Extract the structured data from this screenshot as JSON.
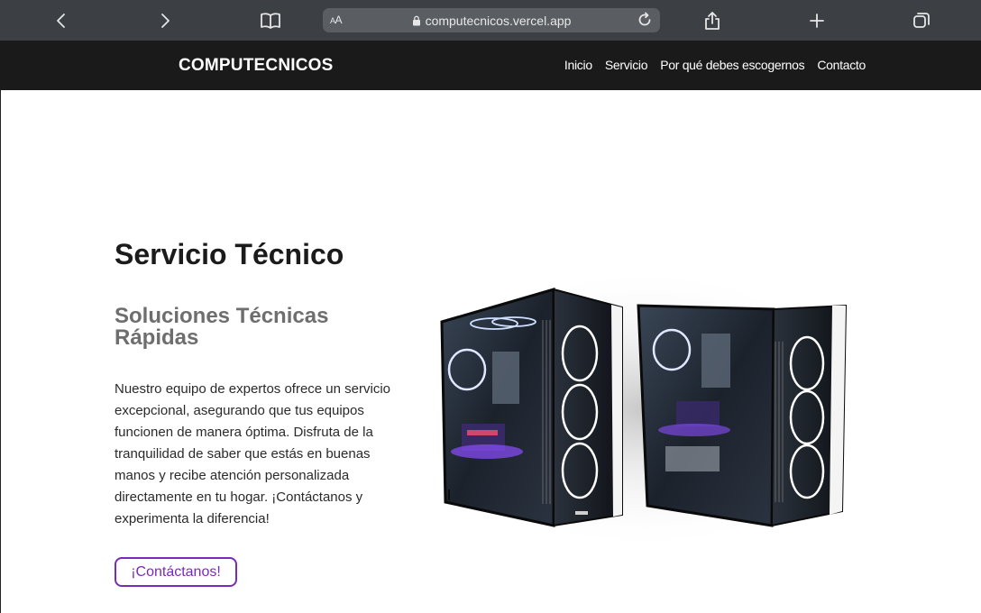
{
  "browser": {
    "url": "computecnicos.vercel.app",
    "reader_label_small": "A",
    "reader_label_large": "A"
  },
  "nav": {
    "brand": "COMPUTECNICOS",
    "links": [
      "Inicio",
      "Servicio",
      "Por qué debes escogernos",
      "Contacto"
    ]
  },
  "hero": {
    "title": "Servicio Técnico",
    "subtitle": "Soluciones Técnicas Rápidas",
    "description": "Nuestro equipo de expertos ofrece un servicio excepcional, asegurando que tus equipos funcionen de manera óptima. Disfruta de la tranquilidad de saber que estás en buenas manos y recibe atención personalizada directamente en tu hogar. ¡Contáctanos y experimenta la diferencia!",
    "cta_label": "¡Contáctanos!"
  },
  "colors": {
    "browser_bar": "#3c3f43",
    "nav_background": "#1a1a1a",
    "accent": "#7a2bb5"
  }
}
